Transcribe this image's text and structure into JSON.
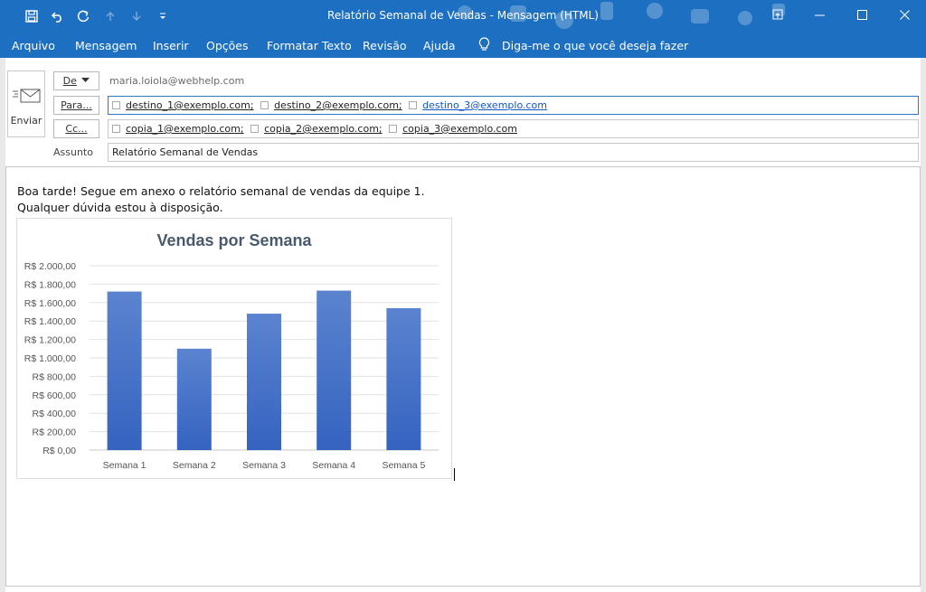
{
  "window": {
    "title": "Relatório Semanal de Vendas  -  Mensagem (HTML)"
  },
  "menu": {
    "tabs": [
      "Arquivo",
      "Mensagem",
      "Inserir",
      "Opções",
      "Formatar Texto",
      "Revisão",
      "Ajuda"
    ],
    "tell_me": "Diga-me o que você deseja fazer"
  },
  "compose": {
    "send_label": "Enviar",
    "from_label": "De",
    "from_address": "maria.loiola@webhelp.com",
    "to_label": "Para...",
    "to": [
      "destino_1@exemplo.com;",
      "destino_2@exemplo.com;",
      "destino_3@exemplo.com"
    ],
    "cc_label": "Cc...",
    "cc": [
      "copia_1@exemplo.com;",
      "copia_2@exemplo.com;",
      "copia_3@exemplo.com"
    ],
    "subject_label": "Assunto",
    "subject": "Relatório Semanal de Vendas"
  },
  "message": {
    "line1": "Boa tarde! Segue em anexo o relatório semanal de vendas da equipe 1.",
    "line2": "Qualquer dúvida estou à disposição."
  },
  "colors": {
    "titlebar": "#1c6fc1",
    "bar_top": "#5b83cf",
    "bar_bottom": "#3563c0",
    "chart_title": "#4a5a6e"
  },
  "chart_data": {
    "type": "bar",
    "title": "Vendas por Semana",
    "categories": [
      "Semana 1",
      "Semana 2",
      "Semana 3",
      "Semana 4",
      "Semana 5"
    ],
    "values": [
      1720,
      1100,
      1480,
      1730,
      1540
    ],
    "yticks": [
      "R$ 0,00",
      "R$ 200,00",
      "R$ 400,00",
      "R$ 600,00",
      "R$ 800,00",
      "R$ 1.000,00",
      "R$ 1.200,00",
      "R$ 1.400,00",
      "R$ 1.600,00",
      "R$ 1.800,00",
      "R$ 2.000,00"
    ],
    "ylim": [
      0,
      2000
    ],
    "grid": true,
    "legend": "none"
  }
}
